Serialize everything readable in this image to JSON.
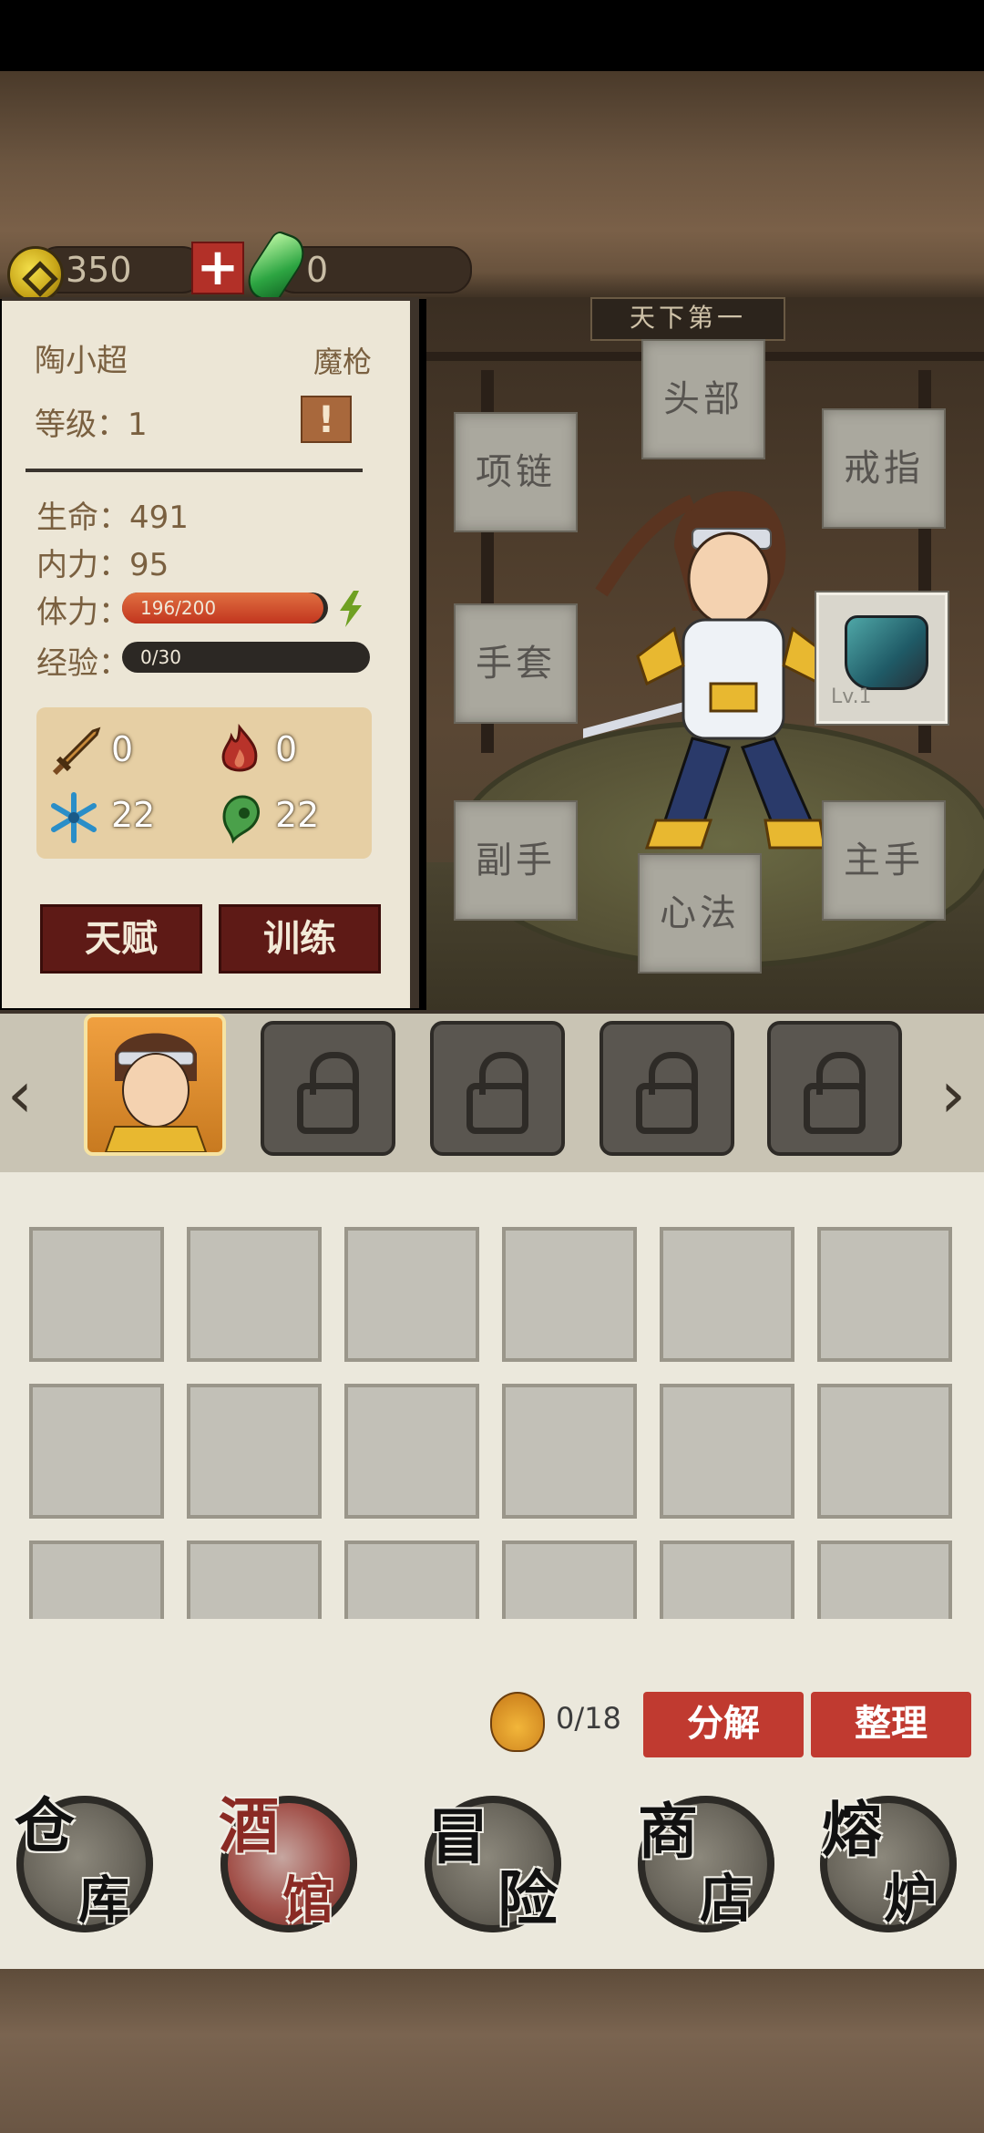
{
  "currency": {
    "coins": "350",
    "gems": "0",
    "plus": "+"
  },
  "hero": {
    "name": "陶小超",
    "class": "魔枪",
    "level_label": "等级：",
    "level": "1",
    "alert": "!",
    "stats": {
      "hp_label": "生命：",
      "hp": "491",
      "mp_label": "内力：",
      "mp": "95",
      "stamina_label": "体力：",
      "stamina_text": "196/200",
      "stamina_fraction": 0.98,
      "exp_label": "经验：",
      "exp_text": "0/30",
      "exp_fraction": 0
    },
    "attributes": [
      {
        "icon": "sword-icon",
        "value": "0"
      },
      {
        "icon": "fire-icon",
        "value": "0"
      },
      {
        "icon": "snowflake-icon",
        "value": "22"
      },
      {
        "icon": "poison-icon",
        "value": "22"
      }
    ],
    "buttons": {
      "talent": "天赋",
      "train": "训练"
    }
  },
  "scene": {
    "sign": "天下第一"
  },
  "equipment_slots": {
    "head": "头部",
    "necklace": "项链",
    "ring": "戒指",
    "gloves": "手套",
    "offhand": "副手",
    "mainhand": "主手",
    "heart": "心法"
  },
  "equipped_item": {
    "level": "Lv.1"
  },
  "character_strip": {
    "left_arrow": "‹",
    "right_arrow": "›",
    "locked_slots": 4
  },
  "inventory": {
    "count_text": "0/18",
    "decompose": "分解",
    "sort": "整理"
  },
  "nav": [
    {
      "label_a": "仓",
      "label_b": "库"
    },
    {
      "label_a": "酒",
      "label_b": "馆"
    },
    {
      "label_a": "冒",
      "label_b": "险"
    },
    {
      "label_a": "商",
      "label_b": "店"
    },
    {
      "label_a": "熔",
      "label_b": "炉"
    }
  ],
  "colors": {
    "accent_red": "#c03a30",
    "dark_red": "#5e1a16",
    "panel": "#ece6d6"
  }
}
